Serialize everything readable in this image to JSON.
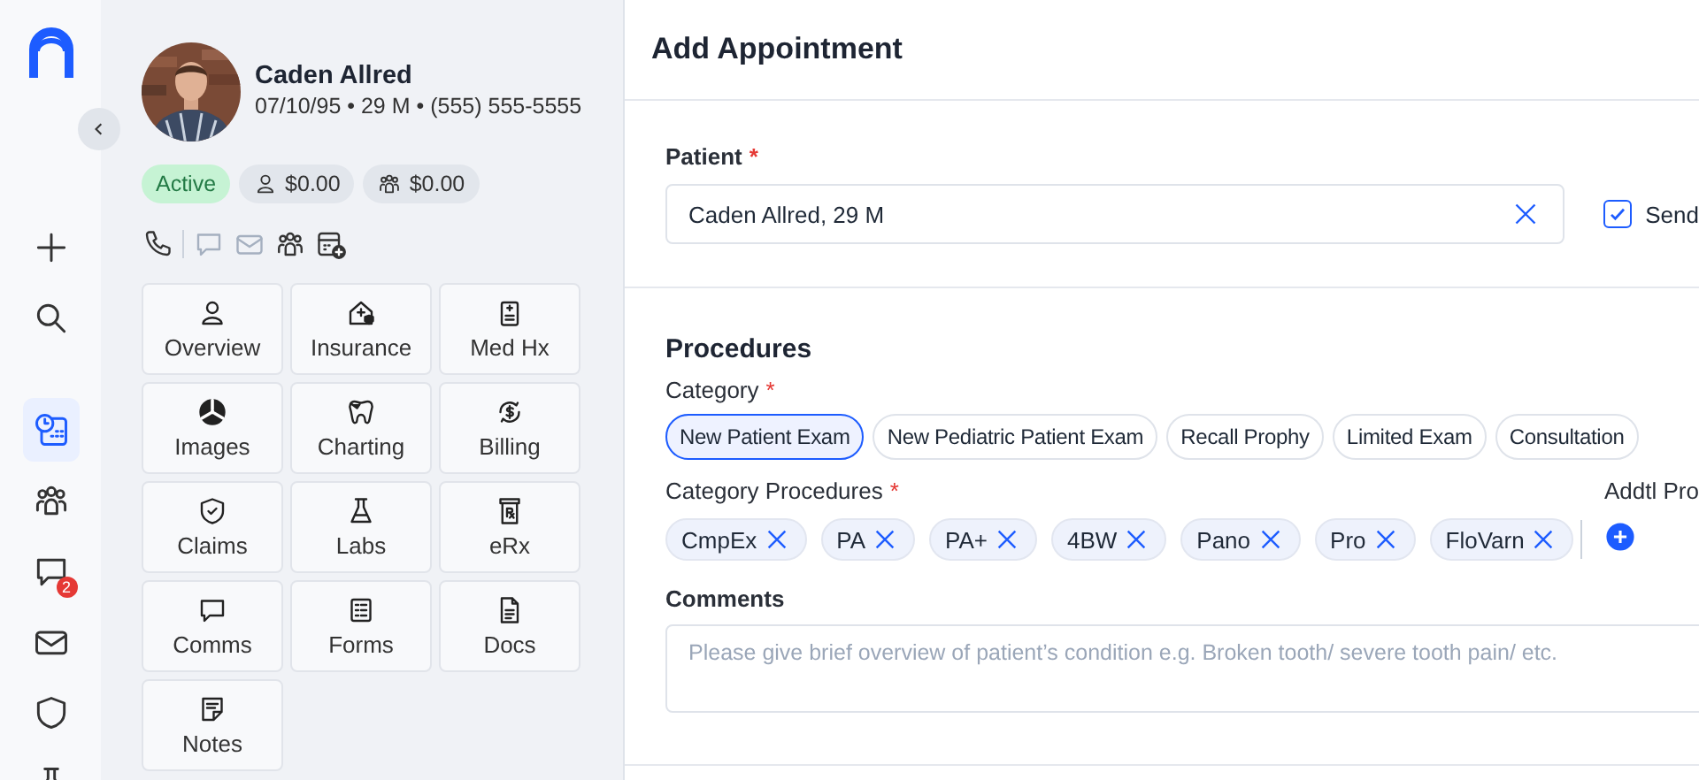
{
  "rail": {
    "tools": [
      {
        "kind": "plus",
        "selected": false
      },
      {
        "kind": "search",
        "selected": false
      }
    ],
    "nav": [
      {
        "kind": "calendar-clock",
        "selected": true
      },
      {
        "kind": "people",
        "selected": false
      },
      {
        "kind": "chat",
        "selected": false,
        "badge": "2"
      },
      {
        "kind": "mail",
        "selected": false
      },
      {
        "kind": "shield",
        "selected": false
      },
      {
        "kind": "flask",
        "selected": false
      }
    ]
  },
  "patient": {
    "name": "Caden Allred",
    "details": "07/10/95 • 29 M • (555) 555-5555",
    "status": "Active",
    "balances": [
      {
        "kind": "person",
        "amount": "$0.00"
      },
      {
        "kind": "people",
        "amount": "$0.00"
      }
    ],
    "actions": [
      {
        "kind": "phone",
        "disabled": false
      },
      {
        "kind": "chat",
        "disabled": true
      },
      {
        "kind": "mail",
        "disabled": true
      },
      {
        "kind": "people",
        "disabled": false
      },
      {
        "kind": "calendar-plus",
        "disabled": false
      }
    ],
    "tiles": [
      {
        "kind": "person",
        "label": "Overview"
      },
      {
        "kind": "house-plus",
        "label": "Insurance"
      },
      {
        "kind": "clipboard",
        "label": "Med Hx"
      },
      {
        "kind": "radiation",
        "label": "Images"
      },
      {
        "kind": "tooth",
        "label": "Charting"
      },
      {
        "kind": "dollar-cycle",
        "label": "Billing"
      },
      {
        "kind": "shield-check",
        "label": "Claims"
      },
      {
        "kind": "flask",
        "label": "Labs"
      },
      {
        "kind": "rx-bottle",
        "label": "eRx"
      },
      {
        "kind": "chat",
        "label": "Comms"
      },
      {
        "kind": "form",
        "label": "Forms"
      },
      {
        "kind": "document",
        "label": "Docs"
      },
      {
        "kind": "note",
        "label": "Notes"
      }
    ]
  },
  "header": {
    "title": "Add Appointment"
  },
  "patient_field": {
    "label": "Patient",
    "required_mark": "*",
    "value": "Caden Allred, 29 M"
  },
  "send": {
    "label": "Send",
    "checked": true
  },
  "procedures": {
    "title": "Procedures",
    "category_label": "Category",
    "category_required_mark": "*",
    "categories": [
      {
        "label": "New Patient Exam",
        "selected": true
      },
      {
        "label": "New Pediatric Patient Exam",
        "selected": false
      },
      {
        "label": "Recall Prophy",
        "selected": false
      },
      {
        "label": "Limited Exam",
        "selected": false
      },
      {
        "label": "Consultation",
        "selected": false
      }
    ],
    "codes_label": "Category Procedures",
    "codes_required_mark": "*",
    "codes": [
      "CmpEx",
      "PA",
      "PA+",
      "4BW",
      "Pano",
      "Pro",
      "FloVarn"
    ],
    "addtl_label": "Addtl Pro"
  },
  "comments": {
    "label": "Comments",
    "placeholder": "Please give brief overview of patient’s condition e.g. Broken tooth/ severe tooth pain/ etc."
  }
}
